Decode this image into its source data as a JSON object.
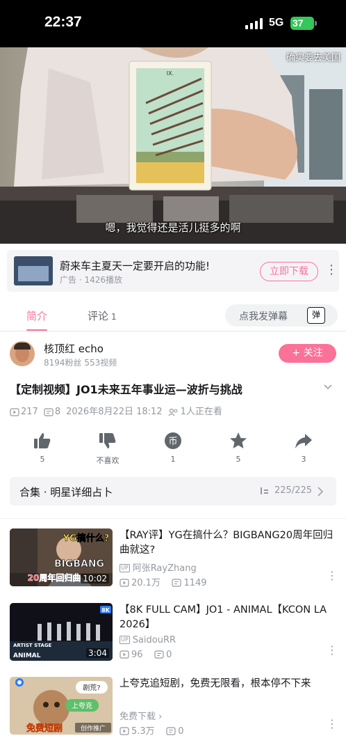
{
  "status": {
    "time": "22:37",
    "network": "5G",
    "battery": "37"
  },
  "video": {
    "watermark": "确实要去美国",
    "subtitle": "嗯，我觉得还是活儿挺多的啊",
    "card_numeral": "IX."
  },
  "ad": {
    "title": "蔚来车主夏天一定要开启的功能!",
    "meta": "广告 · 1426播放",
    "button": "立即下载"
  },
  "tabs": {
    "intro": "简介",
    "comments": "评论",
    "comments_count": "1",
    "danmu_placeholder": "点我发弹幕",
    "danmu_icon": "弹"
  },
  "uploader": {
    "name": "核顶红 echo",
    "stats": "8194粉丝   553视频",
    "follow": "+ 关注"
  },
  "video_info": {
    "title": "【定制视频】JO1未来五年事业运—波折与挑战",
    "views": "217",
    "danmaku": "8",
    "date": "2026年8月22日 18:12",
    "watching": "1人正在看"
  },
  "actions": [
    {
      "label": "5",
      "icon": "like-icon"
    },
    {
      "label": "不喜欢",
      "icon": "dislike-icon"
    },
    {
      "label": "1",
      "icon": "coin-icon"
    },
    {
      "label": "5",
      "icon": "favorite-icon"
    },
    {
      "label": "3",
      "icon": "share-icon"
    }
  ],
  "collection": {
    "title": "合集 · 明星详细占卜",
    "count": "225/225"
  },
  "related": [
    {
      "title": "【RAY评】YG在搞什么？BIGBANG20周年回归曲就这?",
      "up": "阿张RayZhang",
      "views": "20.1万",
      "comments": "1149",
      "duration": "10:02",
      "thumb_texts": [
        "YG搞什么?",
        "BIGBANG",
        "20周年回归曲"
      ]
    },
    {
      "title": "【8K FULL CAM】JO1 - ANIMAL【KCON LA 2026】",
      "up": "SaidouRR",
      "views": "96",
      "comments": "0",
      "duration": "3:04",
      "thumb_texts": [
        "8K",
        "ARTIST STAGE",
        "ANIMAL"
      ]
    },
    {
      "title": "上夸克追短剧，免费无限看，根本停不下来",
      "tag": "免费下载",
      "views": "5.3万",
      "comments": "0",
      "thumb_texts": [
        "剧荒?",
        "上夸克",
        "免费短剧",
        "创作推广"
      ]
    }
  ]
}
